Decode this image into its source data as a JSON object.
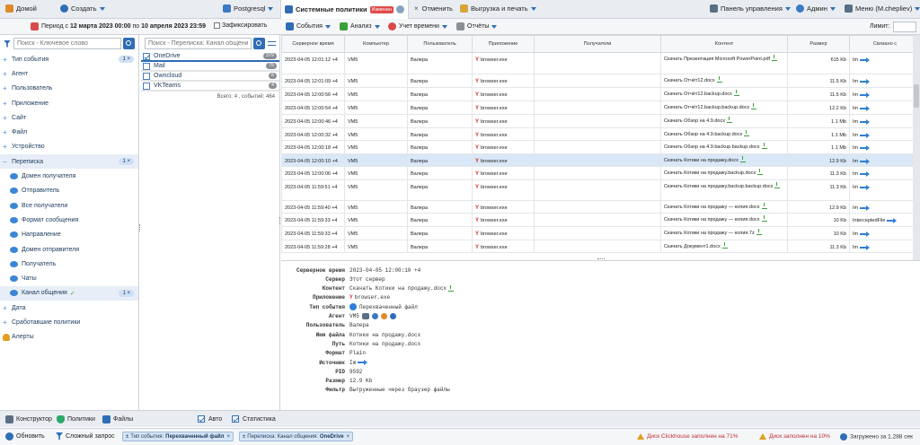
{
  "topbar": {
    "home": "Домой",
    "create": "Создать",
    "db": "Postgresql",
    "tab_title": "Системные политики",
    "tab_badge": "Изменен",
    "cancel": "Отменить",
    "export": "Выгрузка и печать",
    "panel": "Панель управления",
    "admin": "Админ",
    "menu": "Меню (M.chepliev)"
  },
  "period": {
    "prefix": "Период с",
    "from": "12 марта 2023 00:00",
    "mid": "по",
    "to": "10 апреля 2023 23:59",
    "fixed_label": "Зафиксировать"
  },
  "toolbar2": {
    "events": "События",
    "analysis": "Анализ",
    "time": "Учет времени",
    "reports": "Отчёты",
    "limit_label": "Лимит:"
  },
  "leftnav": {
    "search_placeholder": "Поиск - Ключевое слово",
    "items": [
      {
        "label": "Тип события",
        "count": "1 ×",
        "type": "group"
      },
      {
        "label": "Агент",
        "type": "group"
      },
      {
        "label": "Пользователь",
        "type": "group"
      },
      {
        "label": "Приложение",
        "type": "group"
      },
      {
        "label": "Сайт",
        "type": "group"
      },
      {
        "label": "Файл",
        "type": "group"
      },
      {
        "label": "Устройство",
        "type": "group"
      },
      {
        "label": "Переписка",
        "count": "1 ×",
        "type": "open"
      },
      {
        "label": "Домен получателя",
        "type": "sub"
      },
      {
        "label": "Отправитель",
        "type": "sub"
      },
      {
        "label": "Все получатели",
        "type": "sub"
      },
      {
        "label": "Формат сообщения",
        "type": "sub"
      },
      {
        "label": "Направление",
        "type": "sub"
      },
      {
        "label": "Домен отправителя",
        "type": "sub"
      },
      {
        "label": "Получатель",
        "type": "sub"
      },
      {
        "label": "Чаты",
        "type": "sub"
      },
      {
        "label": "Канал общения",
        "count": "1 ×",
        "type": "subsel"
      },
      {
        "label": "Дата",
        "type": "group"
      },
      {
        "label": "Сработавшие политики",
        "type": "group"
      },
      {
        "label": "Алерты",
        "type": "alert"
      }
    ]
  },
  "midpanel": {
    "search_placeholder": "Поиск - Переписка: Канал общения",
    "channels": [
      {
        "label": "OneDrive",
        "count": "379",
        "checked": true
      },
      {
        "label": "Mail",
        "count": "75",
        "checked": false
      },
      {
        "label": "Owncloud",
        "count": "6",
        "checked": false
      },
      {
        "label": "VKTeams",
        "count": "4",
        "checked": false
      }
    ],
    "total": "Всего: 4 , событий: 464"
  },
  "table": {
    "headers": [
      "Серверное время",
      "Компьютер",
      "Пользователь",
      "Приложение",
      "Получатели",
      "Контент",
      "Размер",
      "Связано с"
    ],
    "rows": [
      {
        "time": "2023-04-05 12:01:12 +4",
        "pc": "VM5",
        "user": "Валера",
        "app": "browser.exe",
        "content": "Скачать Презентация Microsoft PowerPoint.pdf",
        "size": "615 Kb",
        "rel": "Im",
        "h": 24
      },
      {
        "time": "2023-04-05 12:01:09 +4",
        "pc": "VM5",
        "user": "Валера",
        "app": "browser.exe",
        "content": "Скачать Отчёт12.docx",
        "size": "11.5 Kb",
        "rel": "Im",
        "h": 15
      },
      {
        "time": "2023-04-05 12:00:56 +4",
        "pc": "VM5",
        "user": "Валера",
        "app": "browser.exe",
        "content": "Скачать Отчёт12.backup.docx",
        "size": "11.5 Kb",
        "rel": "Im",
        "h": 15
      },
      {
        "time": "2023-04-05 12:00:54 +4",
        "pc": "VM5",
        "user": "Валера",
        "app": "browser.exe",
        "content": "Скачать Отчёт12.backup.backup.docx",
        "size": "12.2 Kb",
        "rel": "Im",
        "h": 15
      },
      {
        "time": "2023-04-05 12:00:46 +4",
        "pc": "VM5",
        "user": "Валера",
        "app": "browser.exe",
        "content": "Скачать Обзор на 4.9.docx",
        "size": "1.1 Mb",
        "rel": "Im",
        "h": 15
      },
      {
        "time": "2023-04-05 12:00:32 +4",
        "pc": "VM5",
        "user": "Валера",
        "app": "browser.exe",
        "content": "Скачать Обзор на 4.9.backup.docx",
        "size": "1.1 Mb",
        "rel": "Im",
        "h": 14
      },
      {
        "time": "2023-04-05 12:00:18 +4",
        "pc": "VM5",
        "user": "Валера",
        "app": "browser.exe",
        "content": "Скачать Обзор на 4.9.backup.backup.docx",
        "size": "1.1 Mb",
        "rel": "Im",
        "h": 15
      },
      {
        "time": "2023-04-05 12:00:10 +4",
        "pc": "VM5",
        "user": "Валера",
        "app": "browser.exe",
        "content": "Скачать Котики на продажу.docx",
        "size": "12.9 Kb",
        "rel": "Im",
        "h": 14,
        "hl": true
      },
      {
        "time": "2023-04-05 12:00:06 +4",
        "pc": "VM5",
        "user": "Валера",
        "app": "browser.exe",
        "content": "Скачать Котики на продажу.backup.docx",
        "size": "11.3 Kb",
        "rel": "Im",
        "h": 15
      },
      {
        "time": "2023-04-05 11:59:51 +4",
        "pc": "VM5",
        "user": "Валера",
        "app": "browser.exe",
        "content": "Скачать Котики на продажу.backup.backup.docx",
        "size": "11.3 Kb",
        "rel": "Im",
        "h": 23
      },
      {
        "time": "2023-04-05 11:59:40 +4",
        "pc": "VM5",
        "user": "Валера",
        "app": "browser.exe",
        "content": "Скачать Котики на продажу — копия.docx",
        "size": "12.9 Kb",
        "rel": "Im",
        "h": 14
      },
      {
        "time": "2023-04-05 11:59:33 +4",
        "pc": "VM5",
        "user": "Валера",
        "app": "browser.exe",
        "content": "Скачать Котики на продажу — копия.docx",
        "size": "10 Kb",
        "rel": "InterceptedFile",
        "h": 15
      },
      {
        "time": "2023-04-05 11:59:33 +4",
        "pc": "VM5",
        "user": "Валера",
        "app": "browser.exe",
        "content": "Скачать Котики на продажу — копия.7z",
        "size": "10 Kb",
        "rel": "Im",
        "h": 15
      },
      {
        "time": "2023-04-05 11:59:28 +4",
        "pc": "VM5",
        "user": "Валера",
        "app": "browser.exe",
        "content": "Скачать Документ1.docx",
        "size": "11.3 Kb",
        "rel": "Im",
        "h": 14
      }
    ]
  },
  "detail": {
    "rows": [
      {
        "k": "Серверное время",
        "v": "2023-04-05 12:00:10 +4"
      },
      {
        "k": "Сервер",
        "v": "Этот сервер"
      },
      {
        "k": "Контент",
        "v": "Скачать Котики на продажу.docx"
      },
      {
        "k": "Приложение",
        "v": "browser.exe"
      },
      {
        "k": "Тип события",
        "v": "Перехваченный файл"
      },
      {
        "k": "Агент",
        "v": "VM5"
      },
      {
        "k": "Пользователь",
        "v": "Валера"
      },
      {
        "k": "Имя файла",
        "v": "Котики на продажу.docx"
      },
      {
        "k": "Путь",
        "v": "Котики на продажу.docx"
      },
      {
        "k": "Формат",
        "v": "Plain"
      },
      {
        "k": "Источник",
        "v": "Im"
      },
      {
        "k": "PID",
        "v": "9592"
      },
      {
        "k": "Размер",
        "v": "12.9 Kb"
      },
      {
        "k": "Фильтр",
        "v": "Выгруженные через браузер файлы"
      }
    ]
  },
  "bottom1": {
    "constructor": "Конструктор",
    "policies": "Политики",
    "files": "Файлы",
    "auto": "Авто",
    "stats": "Статистика"
  },
  "bottom2": {
    "refresh": "Обновить",
    "complex": "Сложный запрос",
    "chip1_key": "Тип события:",
    "chip1_val": "Перехваченный файл",
    "chip2_key": "Переписка: Канал общения:",
    "chip2_val": "OneDrive",
    "warn1": "Диск Clickhouse заполнен на 71%",
    "warn2": "Диск заполнен на 10%",
    "loaded": "Загружено за 1.288 сек"
  },
  "colors": {
    "accent": "#2f6db5",
    "highlight": "#d9e7f7",
    "badge_changed": "#e04a4a"
  }
}
